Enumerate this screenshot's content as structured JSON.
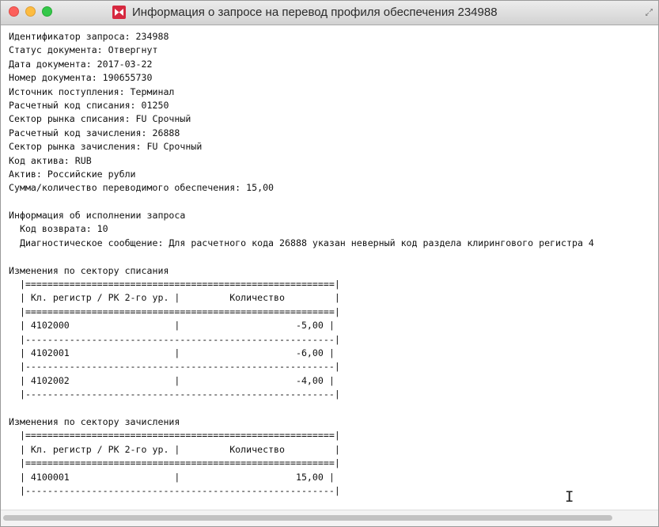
{
  "window": {
    "title": "Информация о запросе на перевод профиля обеспечения 234988",
    "app_icon": "app-logo-icon",
    "colors": {
      "close": "#fc605c",
      "minimize": "#fdbc40",
      "maximize": "#34c84a",
      "app_icon": "#d6283f"
    }
  },
  "document": {
    "header_lines": [
      "Идентификатор запроса: 234988",
      "Статус документа: Отвергнут",
      "Дата документа: 2017-03-22",
      "Номер документа: 190655730",
      "Источник поступления: Терминал",
      "Расчетный код списания: 01250",
      "Сектор рынка списания: FU Срочный",
      "Расчетный код зачисления: 26888",
      "Сектор рынка зачисления: FU Срочный",
      "Код актива: RUB",
      "Актив: Российские рубли",
      "Сумма/количество переводимого обеспечения: 15,00"
    ],
    "execution": {
      "title": "Информация об исполнении запроса",
      "return_code": "  Код возврата: 10",
      "diagnostic": "  Диагностическое сообщение: Для расчетного кода 26888 указан неверный код раздела клирингового регистра 4"
    },
    "debit": {
      "title": "Изменения по сектору списания",
      "lines": [
        "  |========================================================|",
        "  | Кл. регистр / РК 2-го ур. |         Количество         |",
        "  |========================================================|",
        "  | 4102000                   |                     -5,00 |",
        "  |--------------------------------------------------------|",
        "  | 4102001                   |                     -6,00 |",
        "  |--------------------------------------------------------|",
        "  | 4102002                   |                     -4,00 |",
        "  |--------------------------------------------------------|"
      ]
    },
    "credit": {
      "title": "Изменения по сектору зачисления",
      "lines": [
        "  |========================================================|",
        "  | Кл. регистр / РК 2-го ур. |         Количество         |",
        "  |========================================================|",
        "  | 4100001                   |                     15,00 |",
        "  |--------------------------------------------------------|"
      ]
    }
  }
}
